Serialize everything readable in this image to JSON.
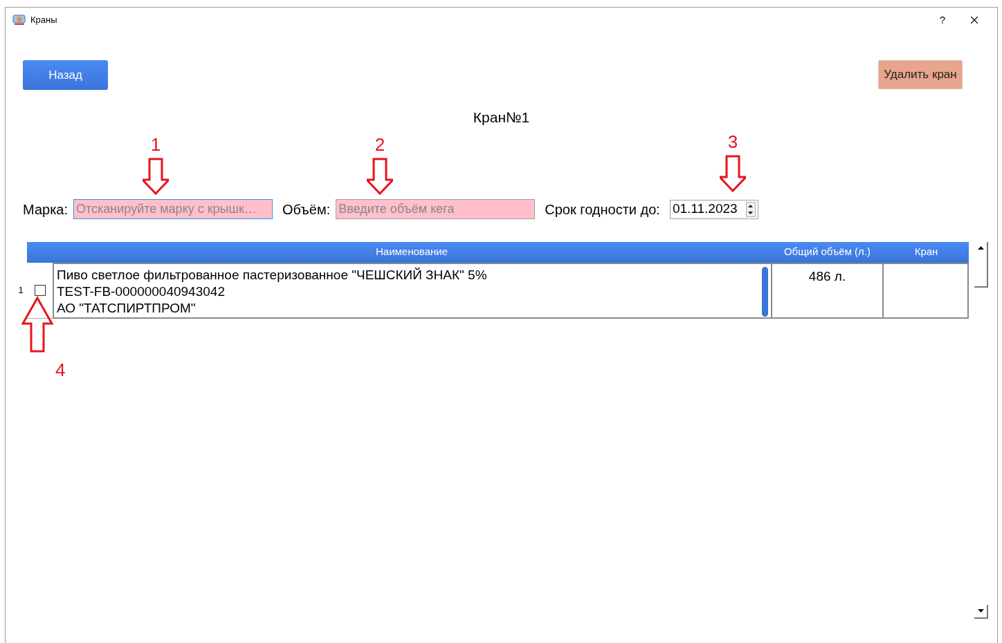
{
  "window": {
    "title": "Краны",
    "help": "?"
  },
  "toolbar": {
    "back_button": "Назад",
    "delete_button": "Удалить кран"
  },
  "heading": "Кран№1",
  "fields": [
    {
      "label": "Марка:",
      "placeholder": "Отсканируйте марку с крышк…",
      "focused": true
    },
    {
      "label": "Объём:",
      "placeholder": "Введите объём кега",
      "focused": false
    }
  ],
  "expiry": {
    "label": "Срок годности до:",
    "value": "01.11.2023"
  },
  "table": {
    "columns": [
      "Наименование",
      "Общий объём (л.)",
      "Кран"
    ],
    "rows": [
      {
        "number": "1",
        "checked": false,
        "name_lines": [
          "Пиво светлое фильтрованное пастеризованное \"ЧЕШСКИЙ ЗНАК\"  5%",
          "TEST-FB-000000040943042",
          "АО \"ТАТСПИРТПРОМ\""
        ],
        "volume": "486 л."
      }
    ]
  },
  "annotations": [
    {
      "label": "1",
      "kind": "down"
    },
    {
      "label": "2",
      "kind": "down"
    },
    {
      "label": "3",
      "kind": "down"
    },
    {
      "label": "4",
      "kind": "up"
    }
  ]
}
